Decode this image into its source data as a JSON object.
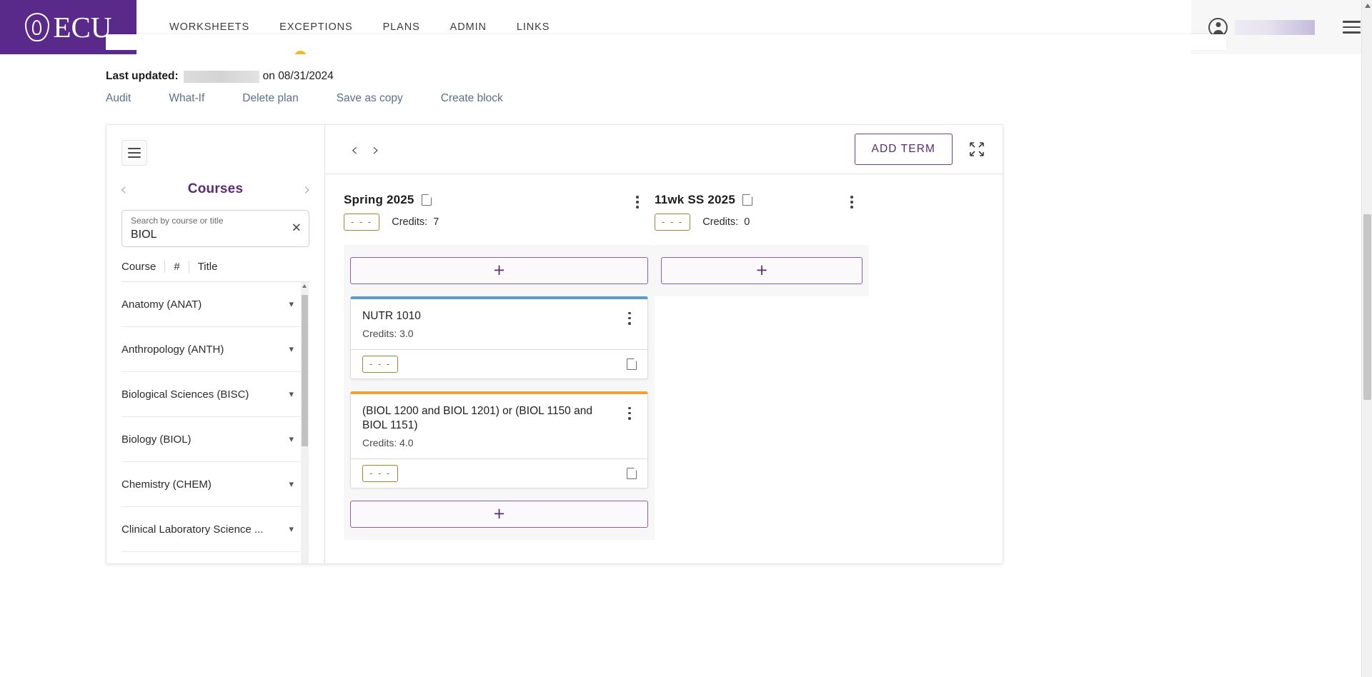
{
  "brand": {
    "name": "ECU",
    "accent_purple": "#592a8a",
    "accent_yellow": "#f5c431",
    "link_blue": "#5b6e8c"
  },
  "nav": {
    "items": [
      {
        "label": "WORKSHEETS",
        "active": false
      },
      {
        "label": "EXCEPTIONS",
        "active": false
      },
      {
        "label": "PLANS",
        "active": true
      },
      {
        "label": "ADMIN",
        "active": false
      },
      {
        "label": "LINKS",
        "active": false
      }
    ]
  },
  "meta": {
    "last_updated_label": "Last updated:",
    "user_redacted": "",
    "on_word": "on",
    "date": "08/31/2024"
  },
  "plan_actions": [
    {
      "label": "Audit"
    },
    {
      "label": "What-If"
    },
    {
      "label": "Delete plan"
    },
    {
      "label": "Save as copy"
    },
    {
      "label": "Create block"
    }
  ],
  "course_panel": {
    "title": "Courses",
    "search": {
      "label": "Search by course or title",
      "value": "BIOL",
      "clear_glyph": "✕"
    },
    "columns": [
      "Course",
      "#",
      "Title"
    ],
    "subjects": [
      {
        "label": "Anatomy (ANAT)"
      },
      {
        "label": "Anthropology (ANTH)"
      },
      {
        "label": "Biological Sciences (BISC)"
      },
      {
        "label": "Biology (BIOL)"
      },
      {
        "label": "Chemistry (CHEM)"
      },
      {
        "label": "Clinical Laboratory Science ..."
      }
    ]
  },
  "toolbar": {
    "prev_glyph": "‹",
    "next_glyph": "›",
    "add_term_label": "ADD TERM"
  },
  "terms": [
    {
      "name": "Spring 2025",
      "status_badge": "- - -",
      "credits_label": "Credits:",
      "credits_value": "7",
      "add_glyph": "+",
      "courses": [
        {
          "title": "NUTR 1010",
          "credits_label": "Credits:",
          "credits_value": "3.0",
          "status_badge": "- - -",
          "accent": "blue"
        },
        {
          "title": "(BIOL 1200 and BIOL 1201) or (BIOL 1150 and BIOL 1151)",
          "credits_label": "Credits:",
          "credits_value": "4.0",
          "status_badge": "- - -",
          "accent": "orange"
        }
      ],
      "trailing_add_glyph": "+"
    },
    {
      "name": "11wk SS 2025",
      "status_badge": "- - -",
      "credits_label": "Credits:",
      "credits_value": "0",
      "add_glyph": "+",
      "courses": [],
      "trailing_add_glyph": ""
    }
  ]
}
